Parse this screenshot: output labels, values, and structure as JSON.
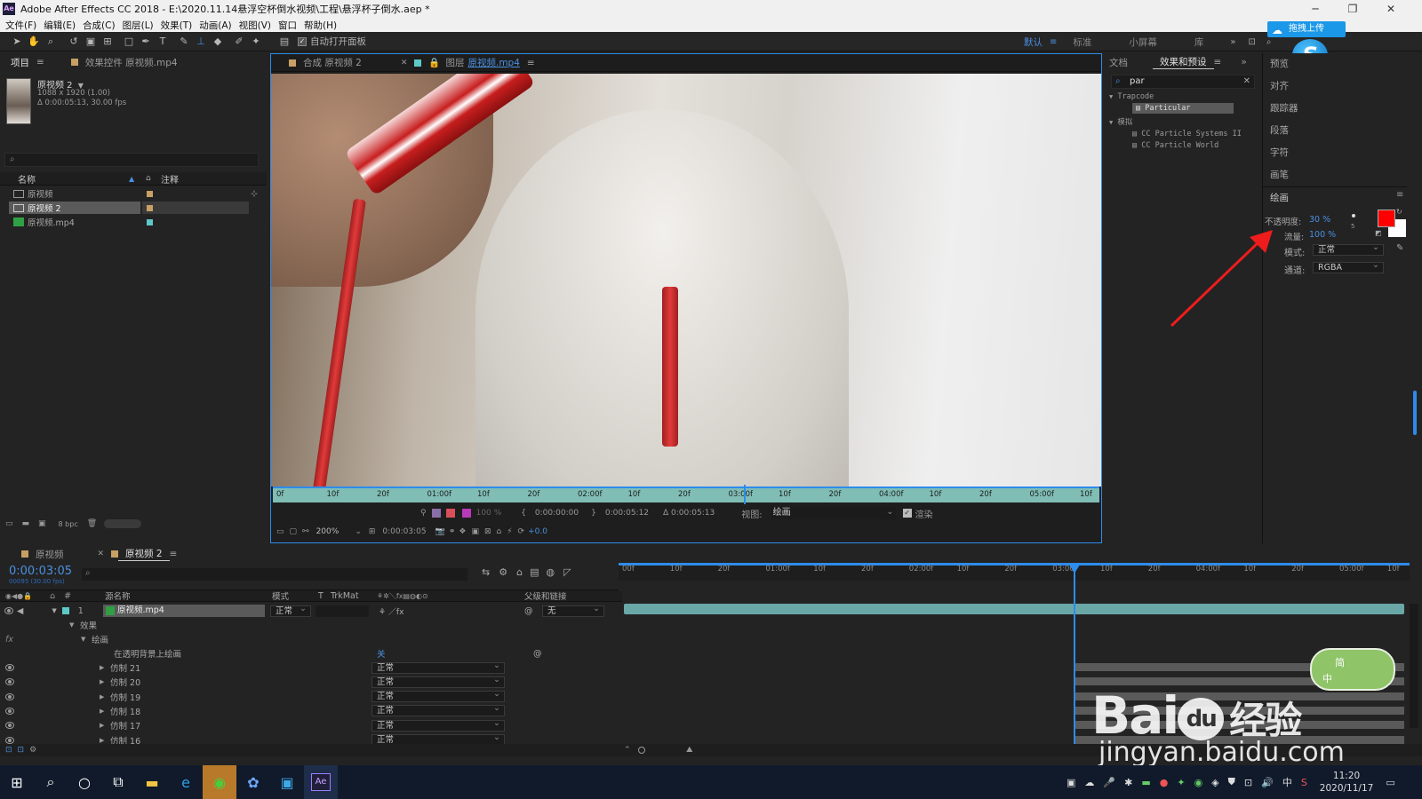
{
  "titlebar": {
    "title": "Adobe After Effects CC 2018 - E:\\2020.11.14悬浮空杯倒水视频\\工程\\悬浮杯子倒水.aep *",
    "app_icon": "Ae"
  },
  "menu": [
    "文件(F)",
    "编辑(E)",
    "合成(C)",
    "图层(L)",
    "效果(T)",
    "动画(A)",
    "视图(V)",
    "窗口",
    "帮助(H)"
  ],
  "toolbar": {
    "auto_open_panel": "自动打开面板",
    "workspaces": [
      "默认",
      "标准",
      "小屏幕",
      "库"
    ],
    "active_workspace": "默认",
    "upload_badge": "拖拽上传"
  },
  "project_panel": {
    "tab": "项目",
    "effects_tab": "效果控件 原视频.mp4",
    "selected_name": "原视频 2",
    "meta1": "1088 x 1920 (1.00)",
    "meta2": "Δ 0:00:05:13, 30.00 fps",
    "col_name": "名称",
    "col_comment": "注释",
    "items": [
      {
        "name": "原视频"
      },
      {
        "name": "原视频 2"
      },
      {
        "name": "原视频.mp4"
      }
    ],
    "bpc": "8 bpc"
  },
  "comp_panel": {
    "tab1": "合成 原视频 2",
    "tab2_prefix": "图层",
    "tab2_name": "原视频.mp4",
    "ruler_labels": [
      "0f",
      "10f",
      "20f",
      "01:00f",
      "10f",
      "20f",
      "02:00f",
      "10f",
      "20f",
      "03:00f",
      "10f",
      "20f",
      "04:00f",
      "10f",
      "20f",
      "05:00f",
      "10f"
    ],
    "time_start": "0:00:00:00",
    "time_end": "0:00:05:12",
    "duration": "Δ 0:00:05:13",
    "view_label": "视图:",
    "view_value": "绘画",
    "render_label": "渲染",
    "opacity": "100 %",
    "zoom": "200%",
    "current_time": "0:00:03:05",
    "exposure": "+0.0"
  },
  "right_panel": {
    "tab_info": "文档",
    "tab_effects": "效果和预设",
    "search": "par",
    "groups": [
      {
        "name": "Trapcode",
        "items": [
          "Particular"
        ]
      },
      {
        "name": "模拟",
        "items": [
          "CC Particle Systems II",
          "CC Particle World"
        ]
      }
    ]
  },
  "side_panel": {
    "items": [
      "预览",
      "对齐",
      "跟踪器",
      "段落",
      "字符",
      "画笔"
    ],
    "paint_title": "绘画",
    "opacity_label": "不透明度:",
    "opacity_value": "30 %",
    "flow_label": "流量:",
    "flow_value": "100 %",
    "mode_label": "模式:",
    "mode_value": "正常",
    "channel_label": "通道:",
    "channel_value": "RGBA",
    "brush_size": "5",
    "fg_color": "#ff0000",
    "bg_color": "#ffffff"
  },
  "timeline": {
    "tab1": "原视频",
    "tab2": "原视频 2",
    "timecode": "0:00:03:05",
    "fps_note": "00095 (30.00 fps)",
    "col_source": "源名称",
    "col_mode": "模式",
    "col_t": "T",
    "col_trkmat": "TrkMat",
    "col_parent": "父级和链接",
    "layer_num": "1",
    "layer_name": "原视频.mp4",
    "layer_mode": "正常",
    "layer_parent": "无",
    "effects_label": "效果",
    "paint_label": "绘画",
    "paint_on_transparent": "在透明背景上绘画",
    "paint_on_value": "关",
    "strokes": [
      {
        "name": "仿制 21",
        "mode": "正常"
      },
      {
        "name": "仿制 20",
        "mode": "正常"
      },
      {
        "name": "仿制 19",
        "mode": "正常"
      },
      {
        "name": "仿制 18",
        "mode": "正常"
      },
      {
        "name": "仿制 17",
        "mode": "正常"
      },
      {
        "name": "仿制 16",
        "mode": "正常"
      }
    ],
    "ruler_labels": [
      "00f",
      "10f",
      "20f",
      "01:00f",
      "10f",
      "20f",
      "02:00f",
      "10f",
      "20f",
      "03:00f",
      "10f",
      "20f",
      "04:00f",
      "10f",
      "20f",
      "05:00f",
      "10f"
    ]
  },
  "watermark": {
    "brand": "Bai",
    "paw": "du",
    "cn": "经验",
    "url": "jingyan.baidu.com",
    "ime1": "简",
    "ime2": "中"
  },
  "taskbar": {
    "time": "11:20",
    "date": "2020/11/17",
    "ime": "中",
    "ae": "Ae"
  },
  "colors": {
    "accent": "#2d8ceb",
    "ruler_teal": "#7fbdb5",
    "layer_bar": "#5fa0a0",
    "arrow": "#ee1c1c"
  }
}
